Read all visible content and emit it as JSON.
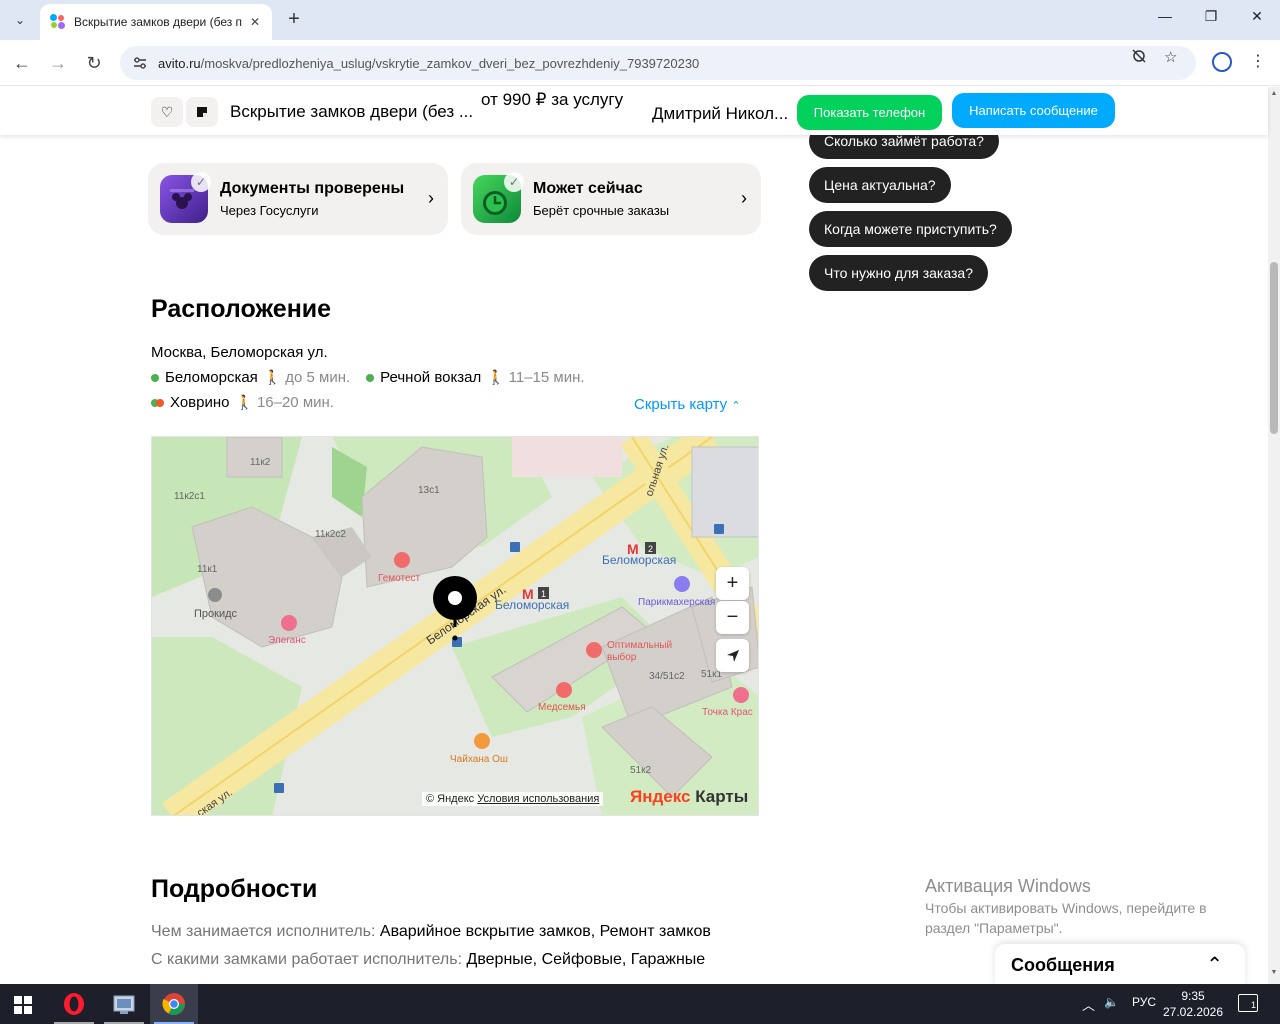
{
  "browser": {
    "tab_title": "Вскрытие замков двери (без п",
    "url_host": "avito.ru",
    "url_path": "/moskva/predlozheniya_uslug/vskrytie_zamkov_dveri_bez_povrezhdeniy_7939720230"
  },
  "sticky": {
    "title": "Вскрытие замков двери (без ...",
    "price": "от 990 ₽ за услугу",
    "seller": "Дмитрий Никол...",
    "show_phone": "Показать телефон",
    "write_message": "Написать сообщение"
  },
  "quick_questions": [
    "Сколько займёт работа?",
    "Цена актуальна?",
    "Когда можете приступить?",
    "Что нужно для заказа?"
  ],
  "badges": [
    {
      "title": "Документы проверены",
      "subtitle": "Через Госуслуги"
    },
    {
      "title": "Может сейчас",
      "subtitle": "Берёт срочные заказы"
    }
  ],
  "location": {
    "heading": "Расположение",
    "address": "Москва, Беломорская ул.",
    "metro": [
      {
        "name": "Беломорская",
        "time": "до 5 мин.",
        "colors": [
          "#4caf50"
        ]
      },
      {
        "name": "Речной вокзал",
        "time": "11–15 мин.",
        "colors": [
          "#4caf50"
        ]
      },
      {
        "name": "Ховрино",
        "time": "16–20 мин.",
        "colors": [
          "#4caf50",
          "#ef5a28"
        ]
      }
    ],
    "hide_map": "Скрыть карту"
  },
  "map": {
    "labels": {
      "b1": "11к2",
      "b2": "11к2с1",
      "b3": "13с1",
      "b4": "11к2с2",
      "b5": "11к1",
      "poi1": "Гемотест",
      "poi2": "Прокидс",
      "poi3": "Элеганс",
      "street1": "Беломорская ул.",
      "street2": "ольная ул.",
      "street3": "ская ул.",
      "metro1": "Беломорская",
      "metro2": "Беломорская",
      "metro1_line": "1",
      "metro2_line": "2",
      "poi4": "Парикмахерская",
      "poi5a": "Оптимальный",
      "poi5b": "выбор",
      "b6": "34/51с2",
      "b7": "51к1",
      "poi6": "Медсемья",
      "poi7": "Точка Крас",
      "poi8": "Чайхана Ош",
      "b8": "51к2"
    },
    "copyright": "© Яндекс",
    "terms": "Условия использования",
    "brand_a": "Яндекс",
    "brand_b": " Карты"
  },
  "details": {
    "heading": "Подробности",
    "rows": [
      {
        "key": "Чем занимается исполнитель:",
        "value": "Аварийное вскрытие замков, Ремонт замков"
      },
      {
        "key": "С какими замками работает исполнитель:",
        "value": "Дверные, Сейфовые, Гаражные"
      }
    ]
  },
  "activation": {
    "title": "Активация Windows",
    "line1": "Чтобы активировать Windows, перейдите в",
    "line2": "раздел \"Параметры\"."
  },
  "messages_panel": {
    "title": "Сообщения"
  },
  "taskbar": {
    "lang": "РУС",
    "time": "9:35",
    "date": "27.02.2026",
    "notifications": "1"
  }
}
